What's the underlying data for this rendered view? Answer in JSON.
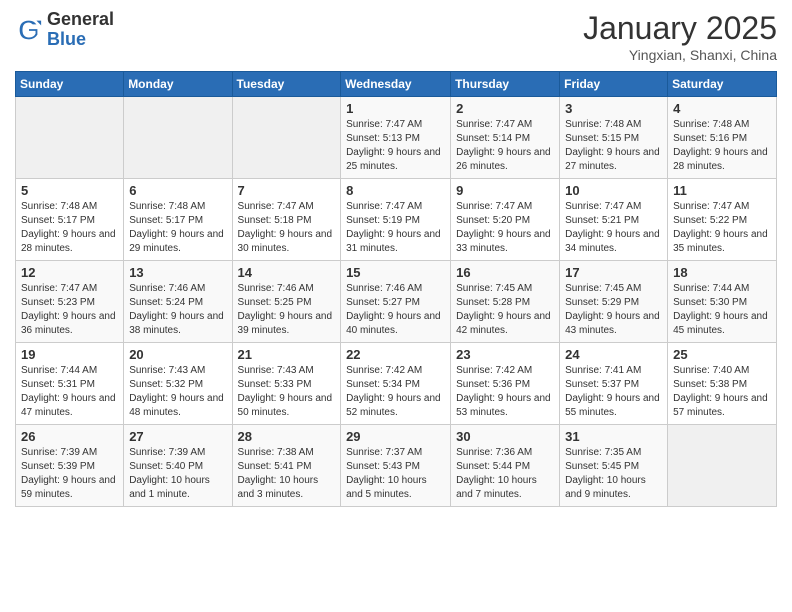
{
  "logo": {
    "general": "General",
    "blue": "Blue"
  },
  "header": {
    "month": "January 2025",
    "location": "Yingxian, Shanxi, China"
  },
  "weekdays": [
    "Sunday",
    "Monday",
    "Tuesday",
    "Wednesday",
    "Thursday",
    "Friday",
    "Saturday"
  ],
  "weeks": [
    [
      {
        "day": "",
        "sunrise": "",
        "sunset": "",
        "daylight": ""
      },
      {
        "day": "",
        "sunrise": "",
        "sunset": "",
        "daylight": ""
      },
      {
        "day": "",
        "sunrise": "",
        "sunset": "",
        "daylight": ""
      },
      {
        "day": "1",
        "sunrise": "Sunrise: 7:47 AM",
        "sunset": "Sunset: 5:13 PM",
        "daylight": "Daylight: 9 hours and 25 minutes."
      },
      {
        "day": "2",
        "sunrise": "Sunrise: 7:47 AM",
        "sunset": "Sunset: 5:14 PM",
        "daylight": "Daylight: 9 hours and 26 minutes."
      },
      {
        "day": "3",
        "sunrise": "Sunrise: 7:48 AM",
        "sunset": "Sunset: 5:15 PM",
        "daylight": "Daylight: 9 hours and 27 minutes."
      },
      {
        "day": "4",
        "sunrise": "Sunrise: 7:48 AM",
        "sunset": "Sunset: 5:16 PM",
        "daylight": "Daylight: 9 hours and 28 minutes."
      }
    ],
    [
      {
        "day": "5",
        "sunrise": "Sunrise: 7:48 AM",
        "sunset": "Sunset: 5:17 PM",
        "daylight": "Daylight: 9 hours and 28 minutes."
      },
      {
        "day": "6",
        "sunrise": "Sunrise: 7:48 AM",
        "sunset": "Sunset: 5:17 PM",
        "daylight": "Daylight: 9 hours and 29 minutes."
      },
      {
        "day": "7",
        "sunrise": "Sunrise: 7:47 AM",
        "sunset": "Sunset: 5:18 PM",
        "daylight": "Daylight: 9 hours and 30 minutes."
      },
      {
        "day": "8",
        "sunrise": "Sunrise: 7:47 AM",
        "sunset": "Sunset: 5:19 PM",
        "daylight": "Daylight: 9 hours and 31 minutes."
      },
      {
        "day": "9",
        "sunrise": "Sunrise: 7:47 AM",
        "sunset": "Sunset: 5:20 PM",
        "daylight": "Daylight: 9 hours and 33 minutes."
      },
      {
        "day": "10",
        "sunrise": "Sunrise: 7:47 AM",
        "sunset": "Sunset: 5:21 PM",
        "daylight": "Daylight: 9 hours and 34 minutes."
      },
      {
        "day": "11",
        "sunrise": "Sunrise: 7:47 AM",
        "sunset": "Sunset: 5:22 PM",
        "daylight": "Daylight: 9 hours and 35 minutes."
      }
    ],
    [
      {
        "day": "12",
        "sunrise": "Sunrise: 7:47 AM",
        "sunset": "Sunset: 5:23 PM",
        "daylight": "Daylight: 9 hours and 36 minutes."
      },
      {
        "day": "13",
        "sunrise": "Sunrise: 7:46 AM",
        "sunset": "Sunset: 5:24 PM",
        "daylight": "Daylight: 9 hours and 38 minutes."
      },
      {
        "day": "14",
        "sunrise": "Sunrise: 7:46 AM",
        "sunset": "Sunset: 5:25 PM",
        "daylight": "Daylight: 9 hours and 39 minutes."
      },
      {
        "day": "15",
        "sunrise": "Sunrise: 7:46 AM",
        "sunset": "Sunset: 5:27 PM",
        "daylight": "Daylight: 9 hours and 40 minutes."
      },
      {
        "day": "16",
        "sunrise": "Sunrise: 7:45 AM",
        "sunset": "Sunset: 5:28 PM",
        "daylight": "Daylight: 9 hours and 42 minutes."
      },
      {
        "day": "17",
        "sunrise": "Sunrise: 7:45 AM",
        "sunset": "Sunset: 5:29 PM",
        "daylight": "Daylight: 9 hours and 43 minutes."
      },
      {
        "day": "18",
        "sunrise": "Sunrise: 7:44 AM",
        "sunset": "Sunset: 5:30 PM",
        "daylight": "Daylight: 9 hours and 45 minutes."
      }
    ],
    [
      {
        "day": "19",
        "sunrise": "Sunrise: 7:44 AM",
        "sunset": "Sunset: 5:31 PM",
        "daylight": "Daylight: 9 hours and 47 minutes."
      },
      {
        "day": "20",
        "sunrise": "Sunrise: 7:43 AM",
        "sunset": "Sunset: 5:32 PM",
        "daylight": "Daylight: 9 hours and 48 minutes."
      },
      {
        "day": "21",
        "sunrise": "Sunrise: 7:43 AM",
        "sunset": "Sunset: 5:33 PM",
        "daylight": "Daylight: 9 hours and 50 minutes."
      },
      {
        "day": "22",
        "sunrise": "Sunrise: 7:42 AM",
        "sunset": "Sunset: 5:34 PM",
        "daylight": "Daylight: 9 hours and 52 minutes."
      },
      {
        "day": "23",
        "sunrise": "Sunrise: 7:42 AM",
        "sunset": "Sunset: 5:36 PM",
        "daylight": "Daylight: 9 hours and 53 minutes."
      },
      {
        "day": "24",
        "sunrise": "Sunrise: 7:41 AM",
        "sunset": "Sunset: 5:37 PM",
        "daylight": "Daylight: 9 hours and 55 minutes."
      },
      {
        "day": "25",
        "sunrise": "Sunrise: 7:40 AM",
        "sunset": "Sunset: 5:38 PM",
        "daylight": "Daylight: 9 hours and 57 minutes."
      }
    ],
    [
      {
        "day": "26",
        "sunrise": "Sunrise: 7:39 AM",
        "sunset": "Sunset: 5:39 PM",
        "daylight": "Daylight: 9 hours and 59 minutes."
      },
      {
        "day": "27",
        "sunrise": "Sunrise: 7:39 AM",
        "sunset": "Sunset: 5:40 PM",
        "daylight": "Daylight: 10 hours and 1 minute."
      },
      {
        "day": "28",
        "sunrise": "Sunrise: 7:38 AM",
        "sunset": "Sunset: 5:41 PM",
        "daylight": "Daylight: 10 hours and 3 minutes."
      },
      {
        "day": "29",
        "sunrise": "Sunrise: 7:37 AM",
        "sunset": "Sunset: 5:43 PM",
        "daylight": "Daylight: 10 hours and 5 minutes."
      },
      {
        "day": "30",
        "sunrise": "Sunrise: 7:36 AM",
        "sunset": "Sunset: 5:44 PM",
        "daylight": "Daylight: 10 hours and 7 minutes."
      },
      {
        "day": "31",
        "sunrise": "Sunrise: 7:35 AM",
        "sunset": "Sunset: 5:45 PM",
        "daylight": "Daylight: 10 hours and 9 minutes."
      },
      {
        "day": "",
        "sunrise": "",
        "sunset": "",
        "daylight": ""
      }
    ]
  ]
}
